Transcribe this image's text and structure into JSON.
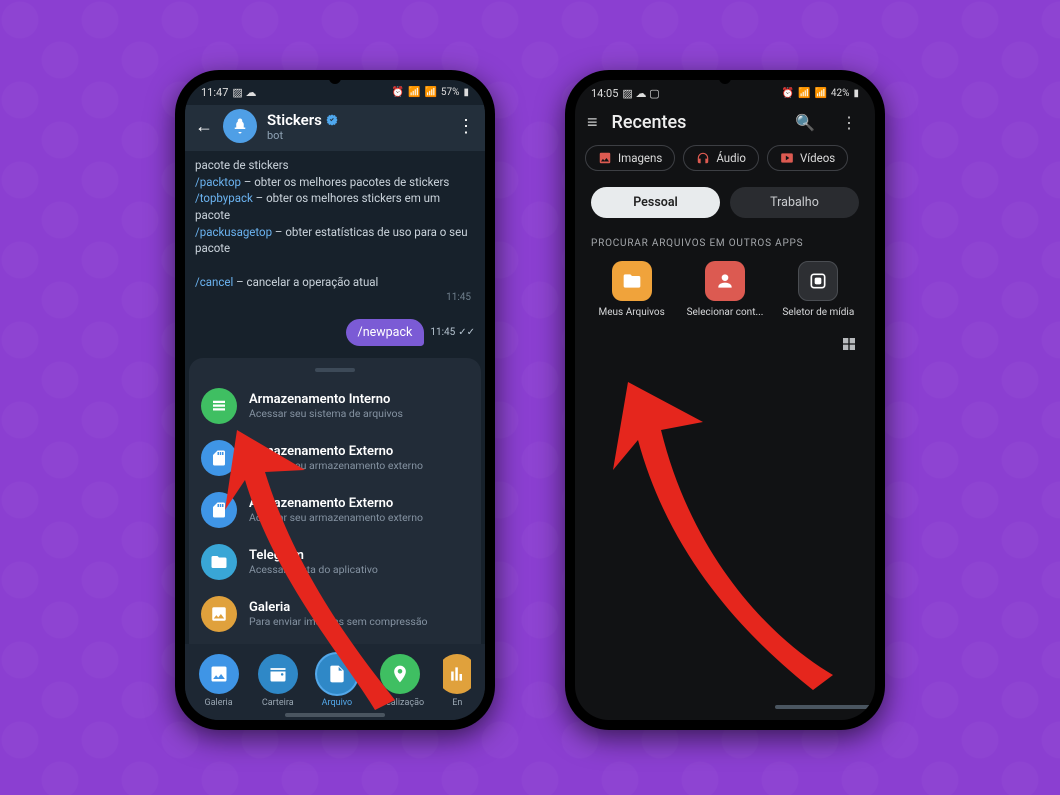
{
  "phone1": {
    "status": {
      "time": "11:47",
      "battery": "57%"
    },
    "header": {
      "title": "Stickers",
      "subtitle": "bot"
    },
    "chat": {
      "line1_pre": "pacote de stickers",
      "cmd_packtop": "/packtop",
      "packtop_desc": " – obter os melhores pacotes de stickers",
      "cmd_topbypack": "/topbypack",
      "topbypack_desc": " – obter os melhores stickers em um pacote",
      "cmd_packusagetop": "/packusagetop",
      "packusagetop_desc": " – obter estatísticas de uso para o seu pacote",
      "cmd_cancel": "/cancel",
      "cancel_desc": " – cancelar a operação atual",
      "msg_time": "11:45",
      "outgoing_text": "/newpack",
      "outgoing_time": "11:45"
    },
    "sheet": [
      {
        "title": "Armazenamento Interno",
        "subtitle": "Acessar seu sistema de arquivos"
      },
      {
        "title": "Armazenamento Externo",
        "subtitle": "Acessar seu armazenamento externo"
      },
      {
        "title": "Armazenamento Externo",
        "subtitle": "Acessar seu armazenamento externo"
      },
      {
        "title": "Telegram",
        "subtitle": "Acessar pasta do aplicativo"
      },
      {
        "title": "Galeria",
        "subtitle": "Para enviar imagens sem compressão"
      }
    ],
    "attach": {
      "gallery": "Galeria",
      "wallet": "Carteira",
      "file": "Arquivo",
      "location": "Localização",
      "mail": "En"
    }
  },
  "phone2": {
    "status": {
      "time": "14:05",
      "battery": "42%"
    },
    "title": "Recentes",
    "chips": {
      "images": "Imagens",
      "audio": "Áudio",
      "videos": "Vídeos"
    },
    "tabs": {
      "personal": "Pessoal",
      "work": "Trabalho"
    },
    "section_label": "PROCURAR ARQUIVOS EM OUTROS APPS",
    "apps": {
      "files": "Meus Arquivos",
      "contacts": "Selecionar cont...",
      "media": "Seletor de mídia"
    }
  }
}
